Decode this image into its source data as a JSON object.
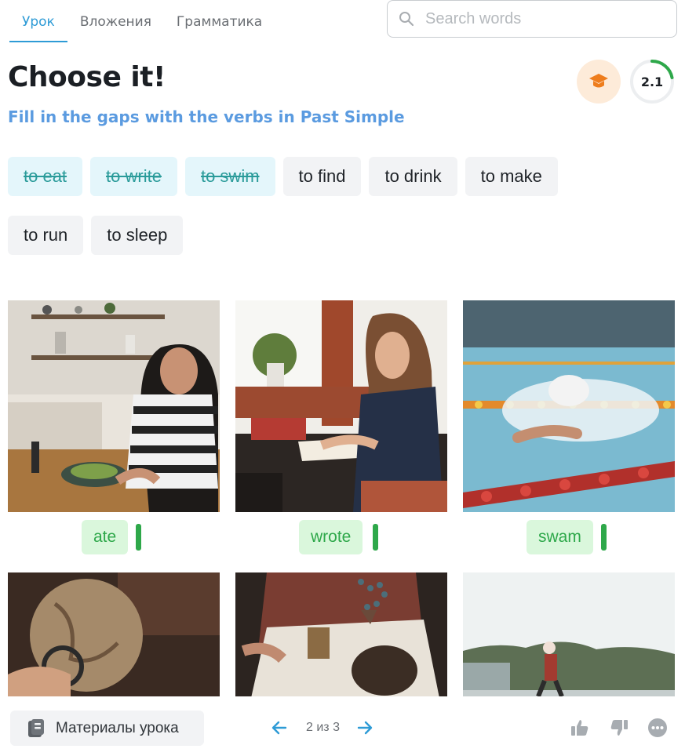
{
  "tabs": [
    {
      "label": "Урок",
      "active": true
    },
    {
      "label": "Вложения",
      "active": false
    },
    {
      "label": "Грамматика",
      "active": false
    }
  ],
  "search": {
    "placeholder": "Search words",
    "value": ""
  },
  "exercise": {
    "title": "Choose it!",
    "subtitle": "Fill in the gaps with the verbs in Past Simple",
    "progress_label": "2.1"
  },
  "word_bank": [
    {
      "text": "to eat",
      "used": true
    },
    {
      "text": "to write",
      "used": true
    },
    {
      "text": "to swim",
      "used": true
    },
    {
      "text": "to find",
      "used": false
    },
    {
      "text": "to drink",
      "used": false
    },
    {
      "text": "to make",
      "used": false
    },
    {
      "text": "to run",
      "used": false
    },
    {
      "text": "to sleep",
      "used": false
    }
  ],
  "cards": [
    {
      "photo": "woman-eating-salad-in-kitchen",
      "answer": "ate"
    },
    {
      "photo": "woman-writing-in-notebook",
      "answer": "wrote"
    },
    {
      "photo": "swimmer-in-pool",
      "answer": "swam"
    },
    {
      "photo": "hand-with-magnifier-and-globe",
      "answer": ""
    },
    {
      "photo": "person-holding-pouch",
      "answer": ""
    },
    {
      "photo": "man-running-by-water",
      "answer": ""
    }
  ],
  "footer": {
    "materials_label": "Материалы урока",
    "page_text": "2 из 3"
  },
  "colors": {
    "accent": "#2e9bd6",
    "subtitle": "#5b9be0",
    "correct": "#2ea84a",
    "correct_bg": "#daf7dc",
    "used_chip_bg": "#e4f6fb",
    "used_chip_text": "#2a9b9a",
    "hat_bg": "#fdebd9",
    "hat": "#ee7d1d"
  }
}
